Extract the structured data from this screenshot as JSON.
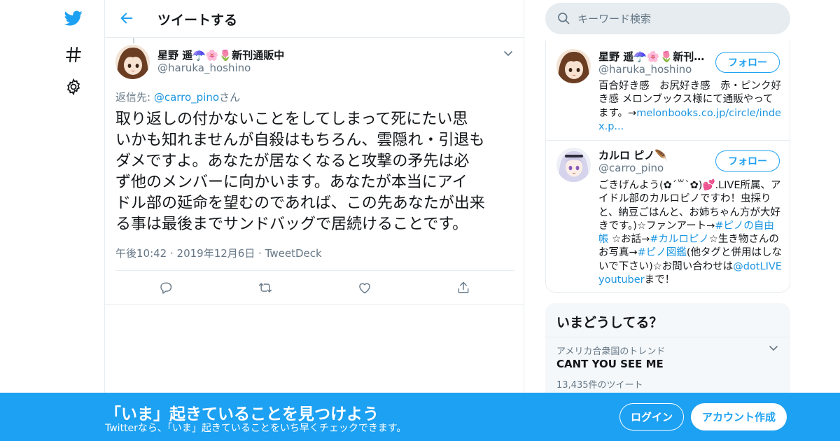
{
  "colors": {
    "accent": "#1da1f2",
    "link": "#1b95e0",
    "muted": "#657786",
    "border": "#e6ecf0",
    "heart": "#e0245e"
  },
  "nav": {
    "logo_icon": "twitter-bird-icon",
    "explore_icon": "hashtag-icon",
    "settings_icon": "gear-icon"
  },
  "header": {
    "title": "ツイートする",
    "back_icon": "back-arrow-icon"
  },
  "tweet": {
    "author_name": "星野 遥☂️🌸🌷新刊通販中",
    "author_handle": "@haruka_hoshino",
    "reply_prefix": "返信先: ",
    "reply_to": "@carro_pino",
    "reply_suffix": "さん",
    "text": "取り返しの付かないことをしてしまって死にたい思\nいかも知れませんが自殺はもちろん、雲隠れ・引退も\nダメですよ。あなたが居なくなると攻撃の矛先は必\nず他のメンバーに向かいます。あなたが本当にアイ\nドル部の延命を望むのであれば、この先あなたが出来\nる事は最後までサンドバッグで居続けることです。",
    "time": "午後10:42",
    "date": "2019年12月6日",
    "source": "TweetDeck",
    "meta_sep": " · ",
    "actions": [
      "reply-icon",
      "retweet-icon",
      "like-icon",
      "share-icon"
    ]
  },
  "search": {
    "placeholder": "キーワード検索"
  },
  "profiles": [
    {
      "name": "星野 遥☂️🌸🌷新刊通販中",
      "handle": "@haruka_hoshino",
      "follow_label": "フォロー",
      "bio_text": "百合好き感　お尻好き感　赤・ピンク好き感 メロンブックス様にて通販やってます。→",
      "bio_link": "melonbooks.co.jp/circle/index.p..."
    },
    {
      "name": "カルロ ピノ🪶",
      "handle": "@carro_pino",
      "follow_label": "フォロー",
      "bio_parts": [
        "ごきげんよう(✿ˊ꒳ˋ✿)💕.LIVE所属、アイドル部のカルロピノですわ！虫採りと、納豆ごはんと、お姉ちゃん方が大好きです。)☆ファンアート→",
        "#ピノの自由帳",
        " ☆お話→",
        "#カルロピノ",
        "☆生き物さんのお写真→",
        "#ピノ図鑑",
        "(他タグと併用はしないで下さい)☆お問い合わせは",
        "@dotLIVEyoutuber",
        "まで！"
      ]
    }
  ],
  "trends": {
    "title": "いまどうしてる？",
    "items": [
      {
        "context": "アメリカ合衆国のトレンド",
        "name": "CANT YOU SEE ME",
        "count": "13,435件のツイート"
      }
    ]
  },
  "bottom_bar": {
    "title": "「いま」起きていることを見つけよう",
    "subtitle": "Twitterなら、「いま」起きていることをいち早くチェックできます。",
    "login_label": "ログイン",
    "signup_label": "アカウント作成"
  }
}
